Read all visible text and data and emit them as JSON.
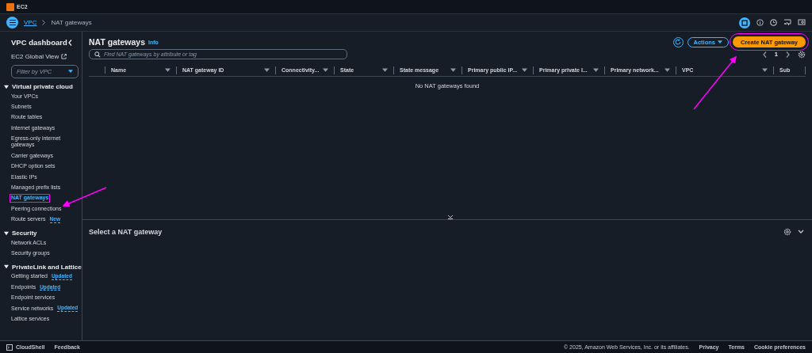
{
  "top_bar": {
    "service": "EC2"
  },
  "breadcrumb": [
    {
      "label": "VPC",
      "link": true
    },
    {
      "label": "NAT gateways",
      "link": false
    }
  ],
  "sidebar": {
    "title": "VPC dashboard",
    "global_view": "EC2 Global View",
    "filter": {
      "placeholder": "Filter by VPC"
    },
    "sections": [
      {
        "title": "Virtual private cloud",
        "expanded": true,
        "items": [
          {
            "label": "Your VPCs",
            "selected": false,
            "highlighted": false
          },
          {
            "label": "Subnets",
            "selected": false,
            "highlighted": false
          },
          {
            "label": "Route tables",
            "selected": false,
            "highlighted": false
          },
          {
            "label": "Internet gateways",
            "selected": false,
            "highlighted": false
          },
          {
            "label": "Egress-only internet gateways",
            "selected": false,
            "highlighted": false
          },
          {
            "label": "Carrier gateways",
            "selected": false,
            "highlighted": false
          },
          {
            "label": "DHCP option sets",
            "selected": false,
            "highlighted": false
          },
          {
            "label": "Elastic IPs",
            "selected": false,
            "highlighted": false
          },
          {
            "label": "Managed prefix lists",
            "selected": false,
            "highlighted": false
          },
          {
            "label": "NAT gateways",
            "selected": true,
            "highlighted": true
          },
          {
            "label": "Peering connections",
            "selected": false,
            "highlighted": false
          },
          {
            "label": "Route servers",
            "badge": "New",
            "selected": false,
            "highlighted": false
          }
        ]
      },
      {
        "title": "Security",
        "expanded": true,
        "items": [
          {
            "label": "Network ACLs",
            "selected": false,
            "highlighted": false
          },
          {
            "label": "Security groups",
            "selected": false,
            "highlighted": false
          }
        ]
      },
      {
        "title": "PrivateLink and Lattice",
        "expanded": true,
        "items": [
          {
            "label": "Getting started",
            "badge": "Updated",
            "selected": false,
            "highlighted": false
          },
          {
            "label": "Endpoints",
            "badge": "Updated",
            "selected": false,
            "highlighted": false
          },
          {
            "label": "Endpoint services",
            "selected": false,
            "highlighted": false
          },
          {
            "label": "Service networks",
            "badge": "Updated",
            "selected": false,
            "highlighted": false
          },
          {
            "label": "Lattice services",
            "selected": false,
            "highlighted": false
          }
        ]
      }
    ]
  },
  "panel": {
    "title": "NAT gateways",
    "info": "Info",
    "search": {
      "placeholder": "Find NAT gateways by attribute or tag"
    },
    "actions": "Actions",
    "create_button": {
      "label": "Create NAT gateway",
      "highlighted": true
    },
    "page": "1",
    "columns": [
      "Name",
      "NAT gateway ID",
      "Connectivity...",
      "State",
      "State message",
      "Primary public IP...",
      "Primary private I...",
      "Primary network...",
      "VPC",
      "Sub"
    ],
    "empty_message": "No NAT gateways found"
  },
  "details": {
    "title": "Select a NAT gateway"
  },
  "footer": {
    "cloudshell": "CloudShell",
    "feedback": "Feedback",
    "copyright": "© 2025, Amazon Web Services, Inc. or its affiliates.",
    "links": [
      "Privacy",
      "Terms",
      "Cookie preferences"
    ]
  }
}
